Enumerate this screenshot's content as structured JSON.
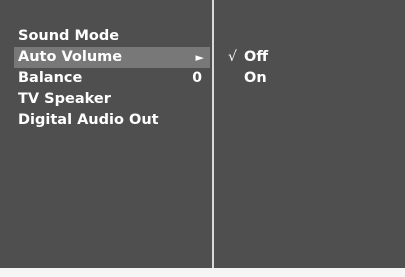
{
  "menu": {
    "items": [
      {
        "label": "Sound Mode",
        "value": ""
      },
      {
        "label": "Auto Volume",
        "value": ""
      },
      {
        "label": "Balance",
        "value": "0"
      },
      {
        "label": "TV Speaker",
        "value": ""
      },
      {
        "label": "Digital Audio Out",
        "value": ""
      }
    ],
    "selected_index": 1,
    "selected_arrow": "►"
  },
  "submenu": {
    "check_mark": "√",
    "options": [
      {
        "label": "Off",
        "checked": true
      },
      {
        "label": "On",
        "checked": false
      }
    ]
  },
  "colors": {
    "panel_bg": "#4f4f4f",
    "selected_bg": "#787878",
    "text": "#ffffff",
    "divider": "#d9d9d9"
  }
}
